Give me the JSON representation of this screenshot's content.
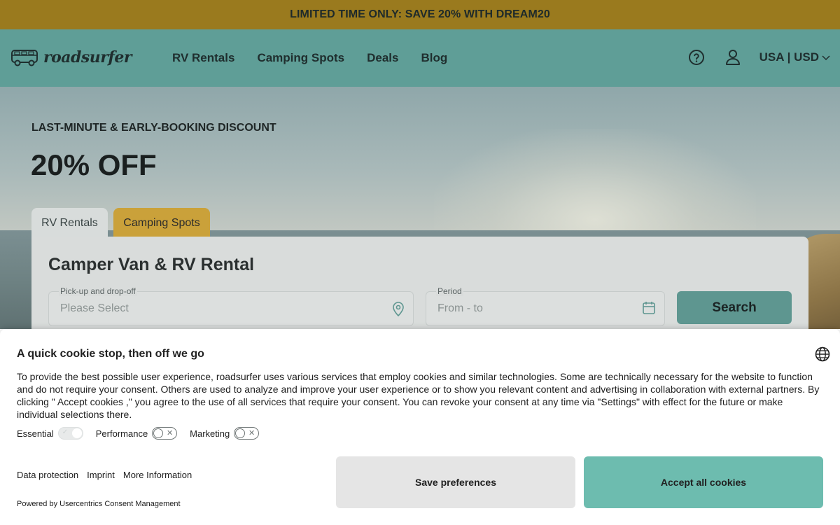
{
  "promo": {
    "text": "LIMITED TIME ONLY: SAVE 20% WITH DREAM20"
  },
  "header": {
    "logo_text": "roadsurfer",
    "nav": [
      "RV Rentals",
      "Camping Spots",
      "Deals",
      "Blog"
    ],
    "locale": "USA | USD",
    "icons": [
      "van-logo-icon",
      "help-icon",
      "user-icon",
      "chevron-down-icon"
    ]
  },
  "hero": {
    "kicker": "LAST-MINUTE & EARLY-BOOKING DISCOUNT",
    "headline": "20% OFF",
    "tabs": [
      "RV Rentals",
      "Camping Spots"
    ],
    "card_title": "Camper Van & RV Rental",
    "pickup": {
      "label": "Pick-up and drop-off",
      "placeholder": "Please Select"
    },
    "period": {
      "label": "Period",
      "placeholder": "From - to"
    },
    "search_label": "Search"
  },
  "cookie": {
    "title": "A quick cookie stop, then off we go",
    "body": "To provide the best possible user experience, roadsurfer uses various services that employ cookies and similar technologies. Some are technically necessary for the website to function and do not require your consent. Others are used to analyze and improve your user experience or to show you relevant content and advertising in collaboration with external partners. By clicking \" Accept cookies ,\" you agree to the use of all services that require your consent. You can revoke your consent at any time via \"Settings\" with effect for the future or make individual selections there.",
    "toggles": [
      {
        "label": "Essential",
        "state": "on-disabled"
      },
      {
        "label": "Performance",
        "state": "off"
      },
      {
        "label": "Marketing",
        "state": "off"
      }
    ],
    "links": [
      "Data protection",
      "Imprint",
      "More Information"
    ],
    "powered": "Powered by Usercentrics Consent Management",
    "save_label": "Save preferences",
    "accept_label": "Accept all cookies"
  },
  "colors": {
    "promo_bg": "#9a7a1e",
    "header_bg": "#5f9e97",
    "accent_teal": "#6dbcaf",
    "camping_tab": "#caa13a"
  }
}
